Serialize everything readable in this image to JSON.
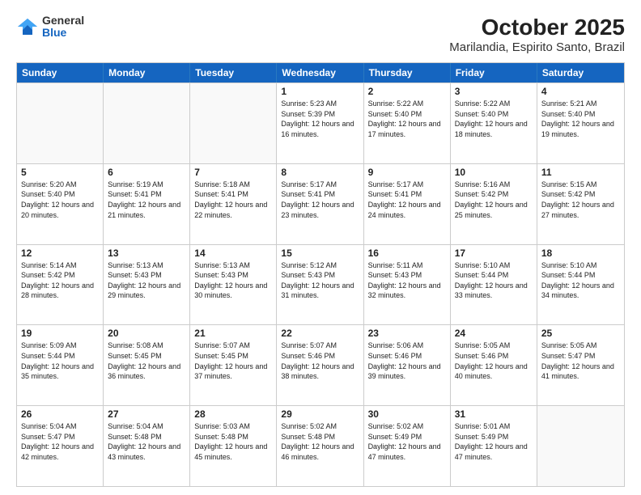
{
  "header": {
    "logo": {
      "general": "General",
      "blue": "Blue"
    },
    "title": "October 2025",
    "subtitle": "Marilandia, Espirito Santo, Brazil"
  },
  "weekdays": [
    "Sunday",
    "Monday",
    "Tuesday",
    "Wednesday",
    "Thursday",
    "Friday",
    "Saturday"
  ],
  "weeks": [
    [
      {
        "day": "",
        "info": "",
        "empty": true
      },
      {
        "day": "",
        "info": "",
        "empty": true
      },
      {
        "day": "",
        "info": "",
        "empty": true
      },
      {
        "day": "1",
        "info": "Sunrise: 5:23 AM\nSunset: 5:39 PM\nDaylight: 12 hours\nand 16 minutes."
      },
      {
        "day": "2",
        "info": "Sunrise: 5:22 AM\nSunset: 5:40 PM\nDaylight: 12 hours\nand 17 minutes."
      },
      {
        "day": "3",
        "info": "Sunrise: 5:22 AM\nSunset: 5:40 PM\nDaylight: 12 hours\nand 18 minutes."
      },
      {
        "day": "4",
        "info": "Sunrise: 5:21 AM\nSunset: 5:40 PM\nDaylight: 12 hours\nand 19 minutes."
      }
    ],
    [
      {
        "day": "5",
        "info": "Sunrise: 5:20 AM\nSunset: 5:40 PM\nDaylight: 12 hours\nand 20 minutes."
      },
      {
        "day": "6",
        "info": "Sunrise: 5:19 AM\nSunset: 5:41 PM\nDaylight: 12 hours\nand 21 minutes."
      },
      {
        "day": "7",
        "info": "Sunrise: 5:18 AM\nSunset: 5:41 PM\nDaylight: 12 hours\nand 22 minutes."
      },
      {
        "day": "8",
        "info": "Sunrise: 5:17 AM\nSunset: 5:41 PM\nDaylight: 12 hours\nand 23 minutes."
      },
      {
        "day": "9",
        "info": "Sunrise: 5:17 AM\nSunset: 5:41 PM\nDaylight: 12 hours\nand 24 minutes."
      },
      {
        "day": "10",
        "info": "Sunrise: 5:16 AM\nSunset: 5:42 PM\nDaylight: 12 hours\nand 25 minutes."
      },
      {
        "day": "11",
        "info": "Sunrise: 5:15 AM\nSunset: 5:42 PM\nDaylight: 12 hours\nand 27 minutes."
      }
    ],
    [
      {
        "day": "12",
        "info": "Sunrise: 5:14 AM\nSunset: 5:42 PM\nDaylight: 12 hours\nand 28 minutes."
      },
      {
        "day": "13",
        "info": "Sunrise: 5:13 AM\nSunset: 5:43 PM\nDaylight: 12 hours\nand 29 minutes."
      },
      {
        "day": "14",
        "info": "Sunrise: 5:13 AM\nSunset: 5:43 PM\nDaylight: 12 hours\nand 30 minutes."
      },
      {
        "day": "15",
        "info": "Sunrise: 5:12 AM\nSunset: 5:43 PM\nDaylight: 12 hours\nand 31 minutes."
      },
      {
        "day": "16",
        "info": "Sunrise: 5:11 AM\nSunset: 5:43 PM\nDaylight: 12 hours\nand 32 minutes."
      },
      {
        "day": "17",
        "info": "Sunrise: 5:10 AM\nSunset: 5:44 PM\nDaylight: 12 hours\nand 33 minutes."
      },
      {
        "day": "18",
        "info": "Sunrise: 5:10 AM\nSunset: 5:44 PM\nDaylight: 12 hours\nand 34 minutes."
      }
    ],
    [
      {
        "day": "19",
        "info": "Sunrise: 5:09 AM\nSunset: 5:44 PM\nDaylight: 12 hours\nand 35 minutes."
      },
      {
        "day": "20",
        "info": "Sunrise: 5:08 AM\nSunset: 5:45 PM\nDaylight: 12 hours\nand 36 minutes."
      },
      {
        "day": "21",
        "info": "Sunrise: 5:07 AM\nSunset: 5:45 PM\nDaylight: 12 hours\nand 37 minutes."
      },
      {
        "day": "22",
        "info": "Sunrise: 5:07 AM\nSunset: 5:46 PM\nDaylight: 12 hours\nand 38 minutes."
      },
      {
        "day": "23",
        "info": "Sunrise: 5:06 AM\nSunset: 5:46 PM\nDaylight: 12 hours\nand 39 minutes."
      },
      {
        "day": "24",
        "info": "Sunrise: 5:05 AM\nSunset: 5:46 PM\nDaylight: 12 hours\nand 40 minutes."
      },
      {
        "day": "25",
        "info": "Sunrise: 5:05 AM\nSunset: 5:47 PM\nDaylight: 12 hours\nand 41 minutes."
      }
    ],
    [
      {
        "day": "26",
        "info": "Sunrise: 5:04 AM\nSunset: 5:47 PM\nDaylight: 12 hours\nand 42 minutes."
      },
      {
        "day": "27",
        "info": "Sunrise: 5:04 AM\nSunset: 5:48 PM\nDaylight: 12 hours\nand 43 minutes."
      },
      {
        "day": "28",
        "info": "Sunrise: 5:03 AM\nSunset: 5:48 PM\nDaylight: 12 hours\nand 45 minutes."
      },
      {
        "day": "29",
        "info": "Sunrise: 5:02 AM\nSunset: 5:48 PM\nDaylight: 12 hours\nand 46 minutes."
      },
      {
        "day": "30",
        "info": "Sunrise: 5:02 AM\nSunset: 5:49 PM\nDaylight: 12 hours\nand 47 minutes."
      },
      {
        "day": "31",
        "info": "Sunrise: 5:01 AM\nSunset: 5:49 PM\nDaylight: 12 hours\nand 47 minutes."
      },
      {
        "day": "",
        "info": "",
        "empty": true
      }
    ]
  ]
}
